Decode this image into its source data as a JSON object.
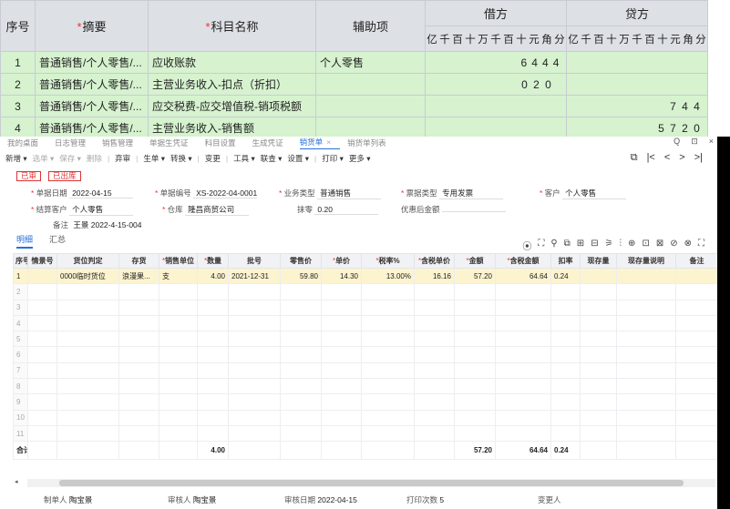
{
  "voucher": {
    "headers": {
      "seq": "序号",
      "summary": "摘要",
      "account": "科目名称",
      "aux": "辅助项",
      "debit": "借方",
      "credit": "贷方",
      "req_mark": "*"
    },
    "digit_labels": [
      "亿",
      "千",
      "百",
      "十",
      "万",
      "千",
      "百",
      "十",
      "元",
      "角",
      "分"
    ],
    "rows": [
      {
        "seq": "1",
        "summary": "普通销售/个人零售/...",
        "account": "应收账款",
        "aux": "个人零售",
        "debit": [
          "6",
          "4",
          "4",
          "4"
        ],
        "credit": []
      },
      {
        "seq": "2",
        "summary": "普通销售/个人零售/...",
        "account": "主营业务收入-扣点（折扣）",
        "aux": "",
        "debit": [
          "0",
          "2",
          "0"
        ],
        "credit": []
      },
      {
        "seq": "3",
        "summary": "普通销售/个人零售/...",
        "account": "应交税费-应交增值税-销项税额",
        "aux": "",
        "debit": [],
        "credit": [
          "7",
          "4",
          "4"
        ]
      },
      {
        "seq": "4",
        "summary": "普通销售/个人零售/...",
        "account": "主营业务收入-销售额",
        "aux": "",
        "debit": [],
        "credit": [
          "5",
          "7",
          "2",
          "0"
        ]
      }
    ]
  },
  "window": {
    "tabs": [
      "我的桌面",
      "日志管理",
      "销售管理",
      "单据生凭证",
      "科目设置",
      "生成凭证",
      "销货单",
      "销货单列表"
    ],
    "active_tab_index": 6,
    "window_controls": [
      "Q",
      "⊡",
      "×"
    ],
    "toolbar": [
      {
        "label": "新增 ▾",
        "disabled": false
      },
      {
        "label": "选单 ▾",
        "disabled": true
      },
      {
        "label": "保存 ▾",
        "disabled": true
      },
      {
        "label": "删除",
        "disabled": true
      },
      {
        "label": "弃审",
        "disabled": false,
        "sep": true
      },
      {
        "label": "生单 ▾",
        "disabled": false,
        "sep": true
      },
      {
        "label": "转换 ▾",
        "disabled": false
      },
      {
        "label": "变更",
        "disabled": false,
        "sep": true
      },
      {
        "label": "工具 ▾",
        "disabled": false,
        "sep": true
      },
      {
        "label": "联查 ▾",
        "disabled": false
      },
      {
        "label": "设置 ▾",
        "disabled": false
      },
      {
        "label": "打印 ▾",
        "disabled": false,
        "sep": true
      },
      {
        "label": "更多 ▾",
        "disabled": false
      }
    ],
    "nav_icons": [
      "⧉",
      "|<",
      "<",
      ">",
      ">|"
    ],
    "stamps": [
      "已审",
      "已出库"
    ],
    "fields": {
      "doc_date": {
        "label": "单据日期",
        "value": "2022-04-15"
      },
      "doc_no": {
        "label": "单据编号",
        "value": "XS-2022-04-0001"
      },
      "biz_type": {
        "label": "业务类型",
        "value": "普通销售"
      },
      "invoice_type": {
        "label": "票据类型",
        "value": "专用发票"
      },
      "customer": {
        "label": "客户",
        "value": "个人零售"
      },
      "settle_customer": {
        "label": "结算客户",
        "value": "个人零售"
      },
      "warehouse": {
        "label": "仓库",
        "value": "隆昌商贸公司"
      },
      "discount": {
        "label": "抹零",
        "value": "0.20"
      },
      "after_discount": {
        "label": "优惠后金额",
        "value": ""
      },
      "remark": {
        "label": "备注",
        "value": "王景 2022-4-15-004"
      }
    },
    "subtabs": [
      "明细",
      "汇总"
    ],
    "grid_icons": [
      "⦿",
      "⛶",
      "⚲",
      "⧉",
      "⊞",
      "⊟",
      "⚞",
      "⫶",
      "⊕",
      "⊡",
      "⊠",
      "⊘",
      "⊗",
      "⛶"
    ],
    "detail": {
      "columns": [
        {
          "label": "序号",
          "req": false
        },
        {
          "label": "情景号",
          "req": false
        },
        {
          "label": "货位判定",
          "req": false
        },
        {
          "label": "存货",
          "req": false
        },
        {
          "label": "销售单位",
          "req": true
        },
        {
          "label": "数量",
          "req": true
        },
        {
          "label": "批号",
          "req": false
        },
        {
          "label": "零售价",
          "req": false
        },
        {
          "label": "单价",
          "req": true
        },
        {
          "label": "税率%",
          "req": true
        },
        {
          "label": "含税单价",
          "req": true
        },
        {
          "label": "金额",
          "req": true
        },
        {
          "label": "含税金额",
          "req": true
        },
        {
          "label": "扣率",
          "req": false
        },
        {
          "label": "现存量",
          "req": false
        },
        {
          "label": "现存量说明",
          "req": false
        },
        {
          "label": "备注",
          "req": false
        }
      ],
      "rows": [
        [
          "1",
          "",
          "0000临时货位",
          "浪漫果...",
          "支",
          "4.00",
          "2021-12-31",
          "59.80",
          "14.30",
          "13.00%",
          "16.16",
          "57.20",
          "64.64",
          "0.24",
          "",
          "",
          ""
        ]
      ],
      "empty_row_numbers": [
        "2",
        "3",
        "4",
        "5",
        "6",
        "7",
        "8",
        "9",
        "10",
        "11"
      ],
      "total": {
        "label": "合计",
        "qty": "4.00",
        "amount": "57.20",
        "tax_amount": "64.64",
        "rate": "0.24"
      }
    },
    "footer": {
      "maker": {
        "label": "制单人",
        "value": "陶宝景"
      },
      "auditor": {
        "label": "审核人",
        "value": "陶宝景"
      },
      "audit_date": {
        "label": "审核日期",
        "value": "2022-04-15"
      },
      "print_count": {
        "label": "打印次数",
        "value": "5"
      },
      "changer": {
        "label": "变更人",
        "value": ""
      }
    }
  },
  "colors": {
    "voucher_header_bg": "#dde0e5",
    "voucher_row_bg": "#d6f2cf",
    "accent_blue": "#2a6fd6",
    "stamp_red": "#dd3333",
    "selected_row_bg": "#fcf3cf"
  }
}
